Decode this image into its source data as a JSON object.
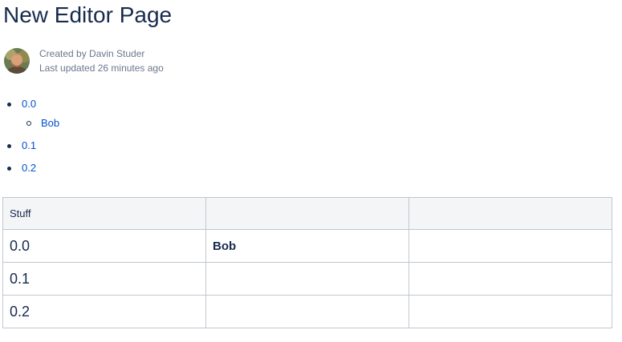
{
  "page": {
    "title": "New Editor Page"
  },
  "byline": {
    "created_by": "Created by Davin Studer",
    "last_updated": "Last updated 26 minutes ago"
  },
  "page_tree": {
    "items": [
      {
        "label": "0.0",
        "children": [
          {
            "label": "Bob"
          }
        ]
      },
      {
        "label": "0.1"
      },
      {
        "label": "0.2"
      }
    ]
  },
  "table": {
    "headers": [
      "Stuff",
      "",
      ""
    ],
    "rows": [
      [
        "0.0",
        "Bob",
        ""
      ],
      [
        "0.1",
        "",
        ""
      ],
      [
        "0.2",
        "",
        ""
      ]
    ]
  }
}
